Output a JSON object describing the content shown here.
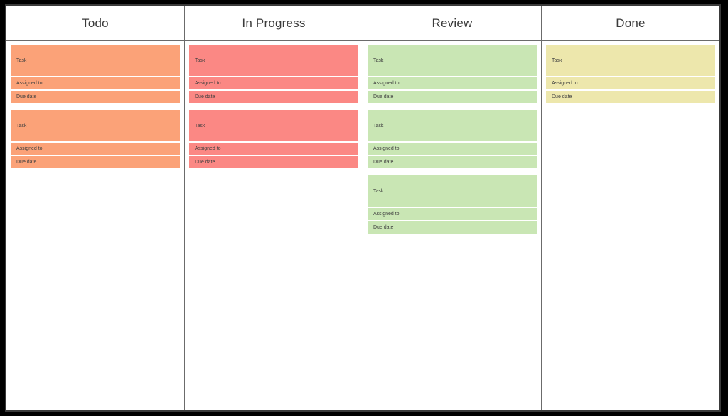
{
  "board": {
    "name": "kanban-board",
    "columns": [
      {
        "id": "todo",
        "title": "Todo",
        "color": "#FBA278",
        "cards": [
          {
            "task_label": "Task",
            "assigned_label": "Assigned to",
            "due_label": "Due date"
          },
          {
            "task_label": "Task",
            "assigned_label": "Assigned to",
            "due_label": "Due date"
          }
        ]
      },
      {
        "id": "inprogress",
        "title": "In Progress",
        "color": "#FB8884",
        "cards": [
          {
            "task_label": "Task",
            "assigned_label": "Assigned to",
            "due_label": "Due date"
          },
          {
            "task_label": "Task",
            "assigned_label": "Assigned to",
            "due_label": "Due date"
          }
        ]
      },
      {
        "id": "review",
        "title": "Review",
        "color": "#C9E6B4",
        "cards": [
          {
            "task_label": "Task",
            "assigned_label": "Assigned to",
            "due_label": "Due date"
          },
          {
            "task_label": "Task",
            "assigned_label": "Assigned to",
            "due_label": "Due date"
          },
          {
            "task_label": "Task",
            "assigned_label": "Assigned to",
            "due_label": "Due date"
          }
        ]
      },
      {
        "id": "done",
        "title": "Done",
        "color": "#EDE7AC",
        "cards": [
          {
            "task_label": "Task",
            "assigned_label": "Assigned to",
            "due_label": "Due date"
          }
        ]
      }
    ]
  }
}
